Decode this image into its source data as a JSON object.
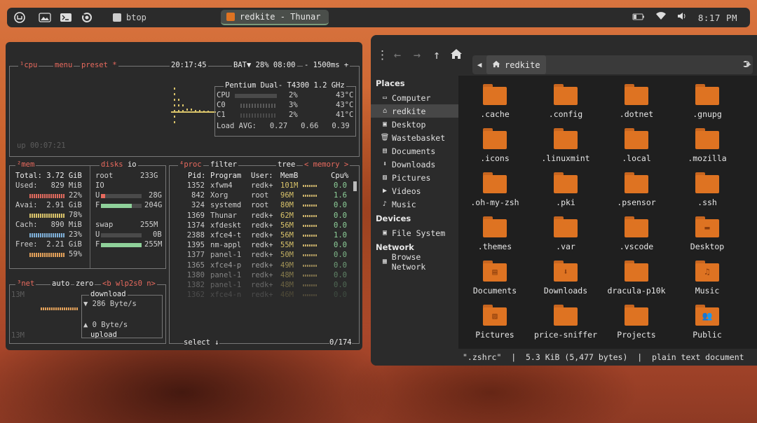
{
  "topbar": {
    "task_btop": "btop",
    "task_thunar": "redkite - Thunar",
    "clock": "8:17 PM"
  },
  "btop": {
    "cpu_label": "¹cpu",
    "menu_label": "menu",
    "preset_label": "preset *",
    "time": "20:17:45",
    "battery": "BAT▼ 28% 08:00",
    "refresh": "- 1500ms +",
    "cpu_model": "Pentium Dual- T4300",
    "cpu_freq": "1.2 GHz",
    "cpu_rows": [
      {
        "name": "CPU",
        "pct": "2%",
        "temp": "43°C"
      },
      {
        "name": "C0",
        "pct": "3%",
        "temp": "43°C"
      },
      {
        "name": "C1",
        "pct": "2%",
        "temp": "41°C"
      }
    ],
    "load_avg": "Load AVG:   0.27   0.66   0.39",
    "uptime": "up 00:07:21",
    "mem": {
      "label": "²mem",
      "total": "Total: 3.72 GiB",
      "used": "Used:   829 MiB",
      "used_pct": "22%",
      "avai": "Avai:  2.91 GiB",
      "avai_pct": "78%",
      "cach": "Cach:   890 MiB",
      "cach_pct": "23%",
      "free": "Free:  2.21 GiB",
      "free_pct": "59%"
    },
    "disks": {
      "label": "disks",
      "io_label": "io",
      "root": "root",
      "root_size": "233G",
      "io": "IO",
      "u": "U",
      "u_val": "28G",
      "f": "F",
      "f_val": "204G",
      "swap": "swap",
      "swap_size": "255M",
      "su": "U",
      "su_val": "0B",
      "sf": "F",
      "sf_val": "255M"
    },
    "proc": {
      "label": "⁴proc",
      "filter": "filter",
      "tree": "tree",
      "memory": "< memory >",
      "headers": {
        "pid": "Pid:",
        "program": "Program",
        "user": "User:",
        "mem": "MemB",
        "cpu": "Cpu%"
      },
      "rows": [
        {
          "pid": "1352",
          "prog": "xfwm4",
          "user": "redk+",
          "mem": "101M",
          "cpu": "0.0"
        },
        {
          "pid": "842",
          "prog": "Xorg",
          "user": "root",
          "mem": "96M",
          "cpu": "1.6"
        },
        {
          "pid": "324",
          "prog": "systemd",
          "user": "root",
          "mem": "80M",
          "cpu": "0.0"
        },
        {
          "pid": "1369",
          "prog": "Thunar",
          "user": "redk+",
          "mem": "62M",
          "cpu": "0.0"
        },
        {
          "pid": "1374",
          "prog": "xfdeskt",
          "user": "redk+",
          "mem": "56M",
          "cpu": "0.0"
        },
        {
          "pid": "2388",
          "prog": "xfce4-t",
          "user": "redk+",
          "mem": "56M",
          "cpu": "1.0"
        },
        {
          "pid": "1395",
          "prog": "nm-appl",
          "user": "redk+",
          "mem": "55M",
          "cpu": "0.0"
        },
        {
          "pid": "1377",
          "prog": "panel-1",
          "user": "redk+",
          "mem": "50M",
          "cpu": "0.0"
        },
        {
          "pid": "1365",
          "prog": "xfce4-p",
          "user": "redk+",
          "mem": "49M",
          "cpu": "0.0"
        },
        {
          "pid": "1380",
          "prog": "panel-1",
          "user": "redk+",
          "mem": "48M",
          "cpu": "0.0"
        },
        {
          "pid": "1382",
          "prog": "panel-1",
          "user": "redk+",
          "mem": "48M",
          "cpu": "0.0"
        },
        {
          "pid": "1362",
          "prog": "xfce4-n",
          "user": "redk+",
          "mem": "46M",
          "cpu": "0.0"
        }
      ],
      "select": "select ↓",
      "count": "0/174"
    },
    "net": {
      "label": "³net",
      "auto": "auto",
      "zero": "zero",
      "iface": "<b wlp2s0 n>",
      "scale_top": "13M",
      "scale_bot": "13M",
      "download": "download",
      "down_rate": "▼ 286 Byte/s",
      "up_rate": "▲ 0 Byte/s",
      "upload": "upload"
    }
  },
  "thunar": {
    "path": "redkite",
    "places_heading": "Places",
    "places": [
      "Computer",
      "redkite",
      "Desktop",
      "Wastebasket",
      "Documents",
      "Downloads",
      "Pictures",
      "Videos",
      "Music"
    ],
    "devices_heading": "Devices",
    "devices": [
      "File System"
    ],
    "network_heading": "Network",
    "network": [
      "Browse Network"
    ],
    "files": [
      ".cache",
      ".config",
      ".dotnet",
      ".gnupg",
      ".icons",
      ".linuxmint",
      ".local",
      ".mozilla",
      ".oh-my-zsh",
      ".pki",
      ".psensor",
      ".ssh",
      ".themes",
      ".var",
      ".vscode",
      "Desktop",
      "Documents",
      "Downloads",
      "dracula-p10k",
      "Music",
      "Pictures",
      "price-sniffer",
      "Projects",
      "Public"
    ],
    "status": "\".zshrc\"  |  5.3 KiB (5,477 bytes)  |  plain text document",
    "colors": {
      "folder": "#de7322",
      "folder_tab": "#c7651f",
      "grid_bg": "#1f1f1f"
    }
  }
}
